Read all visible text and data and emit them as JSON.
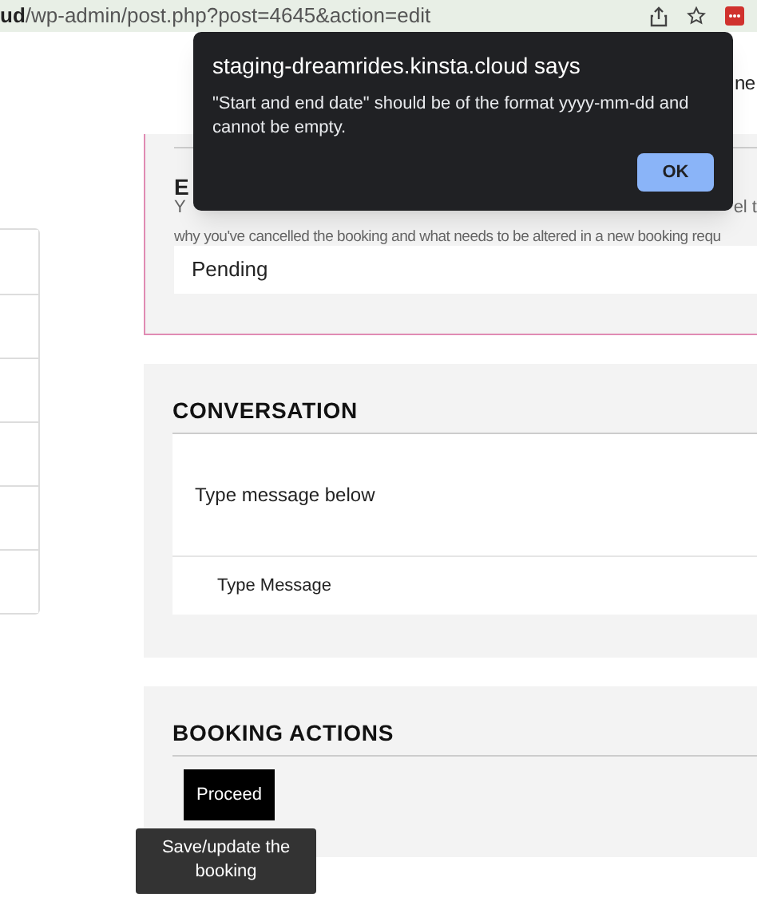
{
  "browser": {
    "url_prefix": "ud",
    "url_path": "/wp-admin/post.php?post=4645&action=edit"
  },
  "page_header_fragment": "ne",
  "status_section": {
    "heading_fragment": "E",
    "description_fragment_1": "Y",
    "description_fragment_2": "el t",
    "description_line_2": "why you've cancelled the booking and what needs to be altered in a new booking requ",
    "status_value": "Pending"
  },
  "conversation": {
    "title": "CONVERSATION",
    "message_area_text": "Type message below",
    "input_placeholder": "Type Message"
  },
  "booking_actions": {
    "title": "BOOKING ACTIONS",
    "button": "Proceed",
    "tooltip": "Save/update the booking"
  },
  "alert": {
    "title": "staging-dreamrides.kinsta.cloud says",
    "message": "\"Start and end date\" should be of the format yyyy-mm-dd and cannot be empty.",
    "button": "OK"
  }
}
